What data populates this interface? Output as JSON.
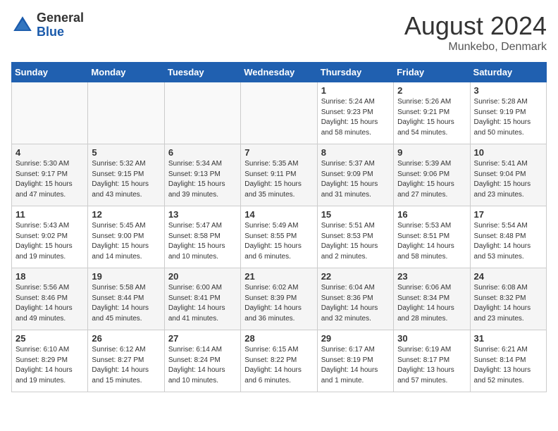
{
  "header": {
    "logo_general": "General",
    "logo_blue": "Blue",
    "title": "August 2024",
    "subtitle": "Munkebo, Denmark"
  },
  "days_of_week": [
    "Sunday",
    "Monday",
    "Tuesday",
    "Wednesday",
    "Thursday",
    "Friday",
    "Saturday"
  ],
  "weeks": [
    [
      {
        "day": "",
        "info": ""
      },
      {
        "day": "",
        "info": ""
      },
      {
        "day": "",
        "info": ""
      },
      {
        "day": "",
        "info": ""
      },
      {
        "day": "1",
        "info": "Sunrise: 5:24 AM\nSunset: 9:23 PM\nDaylight: 15 hours\nand 58 minutes."
      },
      {
        "day": "2",
        "info": "Sunrise: 5:26 AM\nSunset: 9:21 PM\nDaylight: 15 hours\nand 54 minutes."
      },
      {
        "day": "3",
        "info": "Sunrise: 5:28 AM\nSunset: 9:19 PM\nDaylight: 15 hours\nand 50 minutes."
      }
    ],
    [
      {
        "day": "4",
        "info": "Sunrise: 5:30 AM\nSunset: 9:17 PM\nDaylight: 15 hours\nand 47 minutes."
      },
      {
        "day": "5",
        "info": "Sunrise: 5:32 AM\nSunset: 9:15 PM\nDaylight: 15 hours\nand 43 minutes."
      },
      {
        "day": "6",
        "info": "Sunrise: 5:34 AM\nSunset: 9:13 PM\nDaylight: 15 hours\nand 39 minutes."
      },
      {
        "day": "7",
        "info": "Sunrise: 5:35 AM\nSunset: 9:11 PM\nDaylight: 15 hours\nand 35 minutes."
      },
      {
        "day": "8",
        "info": "Sunrise: 5:37 AM\nSunset: 9:09 PM\nDaylight: 15 hours\nand 31 minutes."
      },
      {
        "day": "9",
        "info": "Sunrise: 5:39 AM\nSunset: 9:06 PM\nDaylight: 15 hours\nand 27 minutes."
      },
      {
        "day": "10",
        "info": "Sunrise: 5:41 AM\nSunset: 9:04 PM\nDaylight: 15 hours\nand 23 minutes."
      }
    ],
    [
      {
        "day": "11",
        "info": "Sunrise: 5:43 AM\nSunset: 9:02 PM\nDaylight: 15 hours\nand 19 minutes."
      },
      {
        "day": "12",
        "info": "Sunrise: 5:45 AM\nSunset: 9:00 PM\nDaylight: 15 hours\nand 14 minutes."
      },
      {
        "day": "13",
        "info": "Sunrise: 5:47 AM\nSunset: 8:58 PM\nDaylight: 15 hours\nand 10 minutes."
      },
      {
        "day": "14",
        "info": "Sunrise: 5:49 AM\nSunset: 8:55 PM\nDaylight: 15 hours\nand 6 minutes."
      },
      {
        "day": "15",
        "info": "Sunrise: 5:51 AM\nSunset: 8:53 PM\nDaylight: 15 hours\nand 2 minutes."
      },
      {
        "day": "16",
        "info": "Sunrise: 5:53 AM\nSunset: 8:51 PM\nDaylight: 14 hours\nand 58 minutes."
      },
      {
        "day": "17",
        "info": "Sunrise: 5:54 AM\nSunset: 8:48 PM\nDaylight: 14 hours\nand 53 minutes."
      }
    ],
    [
      {
        "day": "18",
        "info": "Sunrise: 5:56 AM\nSunset: 8:46 PM\nDaylight: 14 hours\nand 49 minutes."
      },
      {
        "day": "19",
        "info": "Sunrise: 5:58 AM\nSunset: 8:44 PM\nDaylight: 14 hours\nand 45 minutes."
      },
      {
        "day": "20",
        "info": "Sunrise: 6:00 AM\nSunset: 8:41 PM\nDaylight: 14 hours\nand 41 minutes."
      },
      {
        "day": "21",
        "info": "Sunrise: 6:02 AM\nSunset: 8:39 PM\nDaylight: 14 hours\nand 36 minutes."
      },
      {
        "day": "22",
        "info": "Sunrise: 6:04 AM\nSunset: 8:36 PM\nDaylight: 14 hours\nand 32 minutes."
      },
      {
        "day": "23",
        "info": "Sunrise: 6:06 AM\nSunset: 8:34 PM\nDaylight: 14 hours\nand 28 minutes."
      },
      {
        "day": "24",
        "info": "Sunrise: 6:08 AM\nSunset: 8:32 PM\nDaylight: 14 hours\nand 23 minutes."
      }
    ],
    [
      {
        "day": "25",
        "info": "Sunrise: 6:10 AM\nSunset: 8:29 PM\nDaylight: 14 hours\nand 19 minutes."
      },
      {
        "day": "26",
        "info": "Sunrise: 6:12 AM\nSunset: 8:27 PM\nDaylight: 14 hours\nand 15 minutes."
      },
      {
        "day": "27",
        "info": "Sunrise: 6:14 AM\nSunset: 8:24 PM\nDaylight: 14 hours\nand 10 minutes."
      },
      {
        "day": "28",
        "info": "Sunrise: 6:15 AM\nSunset: 8:22 PM\nDaylight: 14 hours\nand 6 minutes."
      },
      {
        "day": "29",
        "info": "Sunrise: 6:17 AM\nSunset: 8:19 PM\nDaylight: 14 hours\nand 1 minute."
      },
      {
        "day": "30",
        "info": "Sunrise: 6:19 AM\nSunset: 8:17 PM\nDaylight: 13 hours\nand 57 minutes."
      },
      {
        "day": "31",
        "info": "Sunrise: 6:21 AM\nSunset: 8:14 PM\nDaylight: 13 hours\nand 52 minutes."
      }
    ]
  ]
}
